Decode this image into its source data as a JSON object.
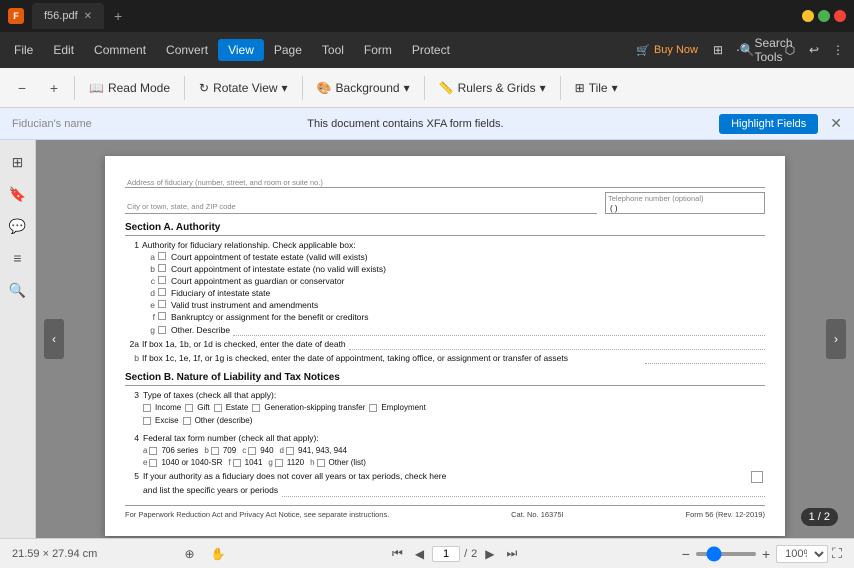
{
  "titlebar": {
    "app_icon": "F",
    "tab_filename": "f56.pdf",
    "tab_close": "✕",
    "tab_new": "+"
  },
  "menubar": {
    "items": [
      {
        "id": "file",
        "label": "File"
      },
      {
        "id": "edit",
        "label": "Edit"
      },
      {
        "id": "comment",
        "label": "Comment"
      },
      {
        "id": "convert",
        "label": "Convert"
      },
      {
        "id": "view",
        "label": "View",
        "active": true
      },
      {
        "id": "page",
        "label": "Page"
      },
      {
        "id": "tool",
        "label": "Tool"
      },
      {
        "id": "form",
        "label": "Form"
      },
      {
        "id": "protect",
        "label": "Protect"
      }
    ],
    "buy_now": "Buy Now",
    "search_tools": "Search Tools"
  },
  "toolbar": {
    "zoom_out": "−",
    "zoom_in": "+",
    "read_mode": "Read Mode",
    "rotate": "Rotate View",
    "rotate_arrow": "▾",
    "background": "Background",
    "background_arrow": "▾",
    "rulers": "Rulers & Grids",
    "rulers_arrow": "▾",
    "tile": "Tile",
    "tile_arrow": "▾"
  },
  "xfa_bar": {
    "field_label": "Fiducian's name",
    "message": "This document contains XFA form fields.",
    "button": "Highlight Fields",
    "close": "✕"
  },
  "pdf": {
    "address_label": "Address of fiduciary (number, street, and room or suite no.)",
    "city_label": "City or town, state, and ZIP code",
    "phone_label": "Telephone number (optional)",
    "section_a_title": "Section A.  Authority",
    "section_a_items": [
      {
        "num": "1",
        "alpha": "",
        "text": "Authority for fiduciary relationship. Check applicable box:"
      },
      {
        "num": "",
        "alpha": "a",
        "text": "Court appointment of testate estate (valid will exists)"
      },
      {
        "num": "",
        "alpha": "b",
        "text": "Court appointment of intestate estate (no valid will exists)"
      },
      {
        "num": "",
        "alpha": "c",
        "text": "Court appointment as guardian or conservator"
      },
      {
        "num": "",
        "alpha": "d",
        "text": "Fiduciary of intestate state"
      },
      {
        "num": "",
        "alpha": "e",
        "text": "Valid trust instrument and amendments"
      },
      {
        "num": "",
        "alpha": "f",
        "text": "Bankruptcy or assignment for the benefit or creditors"
      },
      {
        "num": "",
        "alpha": "g",
        "text": "Other. Describe"
      },
      {
        "num": "2a",
        "alpha": "",
        "text": "If box 1a, 1b, or 1d is checked, enter the date of death"
      },
      {
        "num": "",
        "alpha": "b",
        "text": "If box 1c, 1e, 1f, or 1g is checked, enter the date of appointment, taking office, or assignment or transfer of assets"
      }
    ],
    "section_b_title": "Section B.  Nature of Liability and Tax Notices",
    "section_b_row3_label": "3",
    "section_b_row3_text": "Type of taxes (check all that apply):",
    "tax_types": [
      "Income",
      "Gift",
      "Estate",
      "Generation-skipping transfer",
      "Employment",
      "Excise",
      "Other (describe)"
    ],
    "row4_label": "4",
    "row4_text": "Federal tax form number (check all that apply):",
    "form_numbers": [
      {
        "label": "a",
        "value": "706 series"
      },
      {
        "label": "b",
        "value": "709"
      },
      {
        "label": "c",
        "value": "940"
      },
      {
        "label": "d",
        "value": "941, 943, 944"
      },
      {
        "label": "e",
        "value": "1040 or 1040-SR"
      },
      {
        "label": "f",
        "value": "1041"
      },
      {
        "label": "g",
        "value": "1120"
      },
      {
        "label": "h",
        "value": "Other (list)"
      }
    ],
    "row5_label": "5",
    "row5_text": "If your authority as a fiduciary does not cover all years or tax periods, check here",
    "row5_text2": "and list the specific years or periods",
    "footer_left": "For Paperwork Reduction Act and Privacy Act Notice, see separate instructions.",
    "footer_cat": "Cat. No. 16375I",
    "footer_form": "Form 56 (Rev. 12-2019)"
  },
  "page_indicator": "1 / 2",
  "statusbar": {
    "dimensions": "21.59 × 27.94 cm",
    "page_current": "1",
    "page_total": "2",
    "zoom_value": "100%"
  }
}
